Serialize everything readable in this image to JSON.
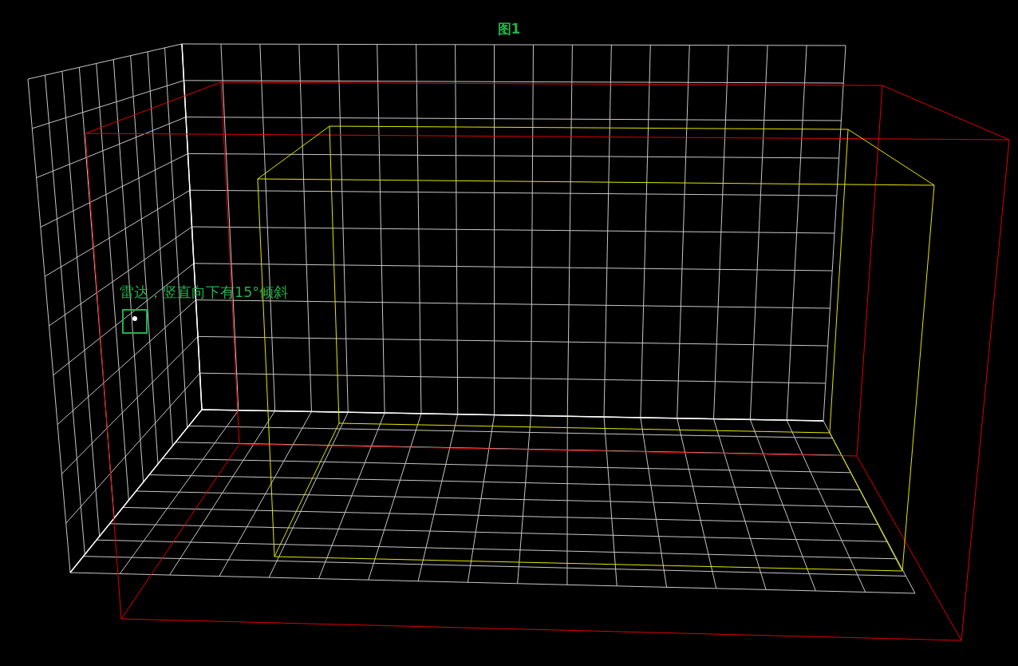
{
  "title": "图1",
  "radar": {
    "label": "雷达，竖直向下有15°倾斜"
  }
}
